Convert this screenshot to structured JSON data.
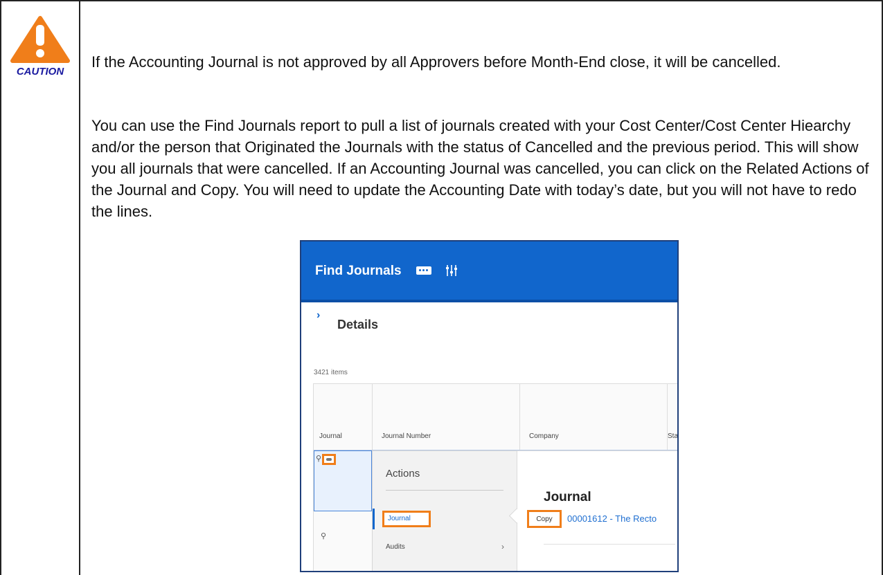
{
  "caution": {
    "icon": "caution-triangle-icon",
    "label": "CAUTION",
    "color": "#f07e1a"
  },
  "notice": {
    "paragraph1": "If the Accounting Journal is not approved by all Approvers before Month-End close, it will be cancelled.",
    "paragraph2": "You can use the Find Journals report to pull a list of journals created with your Cost Center/Cost Center Hiearchy and/or the person that Originated the Journals with the status of Cancelled and the previous period.  This will show you all journals that were cancelled.  If an Accounting Journal was cancelled, you can click on the Related Actions of the Journal and Copy.  You will need to update the Accounting Date with today’s date, but you will not have to redo the lines."
  },
  "screenshot": {
    "header_title": "Find Journals",
    "header_color": "#1166cc",
    "details_label": "Details",
    "items_count": "3421 items",
    "columns": [
      "Journal",
      "Journal Number",
      "Company",
      "Stat"
    ],
    "menu": {
      "title": "Actions",
      "items": [
        "Journal",
        "Audits"
      ]
    },
    "flyout": {
      "title": "Journal",
      "copy_label": "Copy",
      "link_text": "00001612 - The Recto"
    },
    "highlight_color": "#f07e1a"
  }
}
